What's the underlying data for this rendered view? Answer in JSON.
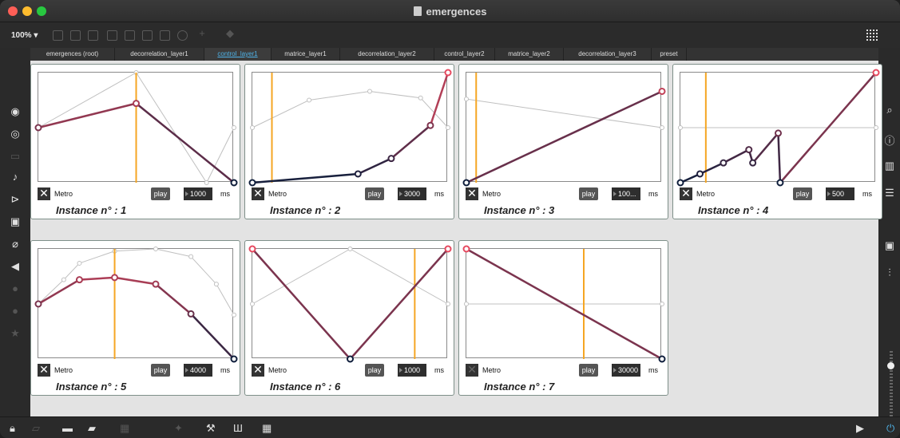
{
  "window": {
    "title": "emergences"
  },
  "toolbar": {
    "zoom": "100%"
  },
  "tabs": [
    {
      "label": "emergences (root)"
    },
    {
      "label": "decorrelation_layer1"
    },
    {
      "label": "control_layer1",
      "active": true
    },
    {
      "label": "matrice_layer1"
    },
    {
      "label": "decorrelation_layer2"
    },
    {
      "label": "control_layer2"
    },
    {
      "label": "matrice_layer2"
    },
    {
      "label": "decorrelation_layer3"
    },
    {
      "label": "preset"
    }
  ],
  "colors": {
    "playhead": "#f5a623",
    "curve_dark": "#0f1e3c",
    "curve_red": "#e6495f",
    "bg_curve": "#c0c0c0",
    "tab_active": "#4fb3e8"
  },
  "instances": [
    {
      "label": "Instance n° :  1",
      "metro": "Metro",
      "play": "play",
      "interval": "1000",
      "unit": "ms",
      "metro_on": true
    },
    {
      "label": "Instance n° :  2",
      "metro": "Metro",
      "play": "play",
      "interval": "3000",
      "unit": "ms",
      "metro_on": true
    },
    {
      "label": "Instance n° :  3",
      "metro": "Metro",
      "play": "play",
      "interval": "100...",
      "unit": "ms",
      "metro_on": true
    },
    {
      "label": "Instance n° :  4",
      "metro": "Metro",
      "play": "play",
      "interval": "500",
      "unit": "ms",
      "metro_on": true
    },
    {
      "label": "Instance n° :  5",
      "metro": "Metro",
      "play": "play",
      "interval": "4000",
      "unit": "ms",
      "metro_on": true
    },
    {
      "label": "Instance n° :  6",
      "metro": "Metro",
      "play": "play",
      "interval": "1000",
      "unit": "ms",
      "metro_on": true
    },
    {
      "label": "Instance n° :  7",
      "metro": "Metro",
      "play": "play",
      "interval": "30000",
      "unit": "ms",
      "metro_on": false
    }
  ],
  "chart_data": [
    {
      "type": "line",
      "playhead": 0.5,
      "bg": [
        [
          0,
          0.5
        ],
        [
          0.5,
          1
        ],
        [
          0.86,
          0
        ],
        [
          1,
          0.5
        ]
      ],
      "fg": [
        [
          0,
          0.5
        ],
        [
          0.5,
          0.72
        ],
        [
          1,
          0
        ]
      ]
    },
    {
      "type": "line",
      "playhead": 0.1,
      "bg": [
        [
          0,
          0.5
        ],
        [
          0.29,
          0.75
        ],
        [
          0.6,
          0.83
        ],
        [
          0.86,
          0.77
        ],
        [
          1,
          0.5
        ]
      ],
      "fg": [
        [
          0,
          0
        ],
        [
          0.54,
          0.08
        ],
        [
          0.71,
          0.22
        ],
        [
          0.91,
          0.52
        ],
        [
          1,
          1
        ]
      ]
    },
    {
      "type": "line",
      "playhead": 0.05,
      "bg": [
        [
          0,
          0.76
        ],
        [
          1,
          0.5
        ]
      ],
      "fg": [
        [
          0,
          0
        ],
        [
          1,
          0.83
        ]
      ]
    },
    {
      "type": "line",
      "playhead": 0.13,
      "bg": [
        [
          0,
          0.5
        ],
        [
          1,
          0.5
        ]
      ],
      "fg": [
        [
          0,
          0
        ],
        [
          0.1,
          0.08
        ],
        [
          0.22,
          0.18
        ],
        [
          0.35,
          0.3
        ],
        [
          0.37,
          0.18
        ],
        [
          0.5,
          0.45
        ],
        [
          0.51,
          0
        ],
        [
          1,
          1
        ]
      ]
    },
    {
      "type": "line",
      "playhead": 0.39,
      "bg": [
        [
          0,
          0.5
        ],
        [
          0.13,
          0.72
        ],
        [
          0.21,
          0.87
        ],
        [
          0.39,
          0.98
        ],
        [
          0.6,
          1
        ],
        [
          0.78,
          0.93
        ],
        [
          0.91,
          0.68
        ],
        [
          1,
          0.4
        ]
      ],
      "fg": [
        [
          0,
          0.5
        ],
        [
          0.21,
          0.72
        ],
        [
          0.39,
          0.74
        ],
        [
          0.6,
          0.68
        ],
        [
          0.78,
          0.41
        ],
        [
          1,
          0
        ]
      ]
    },
    {
      "type": "line",
      "playhead": 0.83,
      "bg": [
        [
          0,
          0.5
        ],
        [
          0.5,
          1
        ],
        [
          1,
          0.5
        ]
      ],
      "fg": [
        [
          0,
          1
        ],
        [
          0.5,
          0
        ],
        [
          1,
          1
        ]
      ]
    },
    {
      "type": "line",
      "playhead": 0.6,
      "bg": [
        [
          0,
          0.5
        ],
        [
          1,
          0.5
        ]
      ],
      "fg": [
        [
          0,
          1
        ],
        [
          1,
          0
        ]
      ]
    }
  ]
}
